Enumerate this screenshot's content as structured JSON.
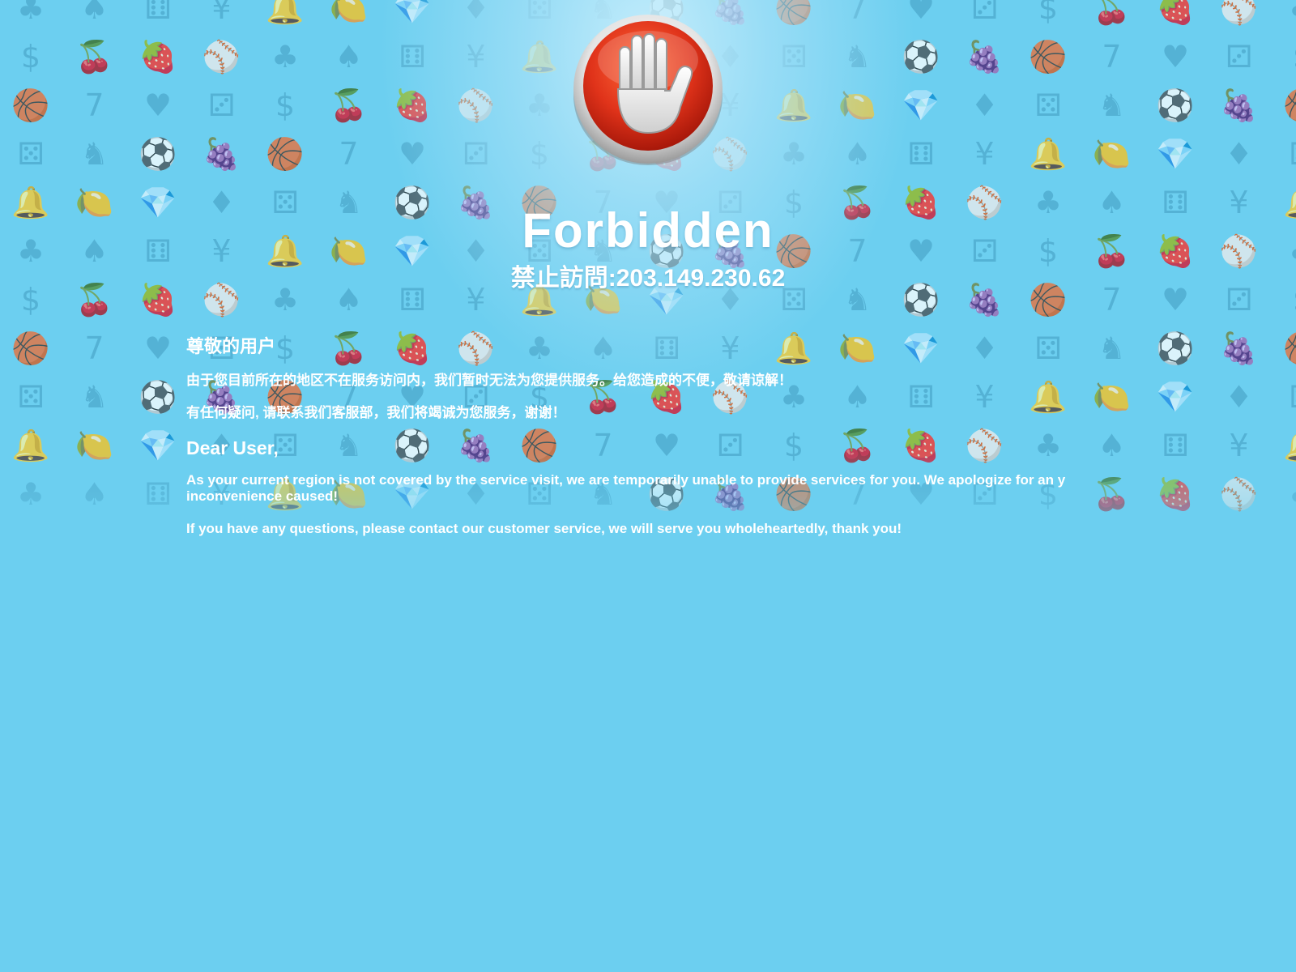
{
  "title": "Forbidden",
  "subtitle": "禁止訪問:203.149.230.62",
  "message": {
    "greeting_cn": "尊敬的用户",
    "para1_cn": "由于您目前所在的地区不在服务访问内，我们暂时无法为您提供服务。给您造成的不便，敬请谅解！",
    "para2_cn": "有任何疑问, 请联系我们客服部，我们将竭诚为您服务，谢谢！",
    "greeting_en": "Dear User,",
    "para1_en": "As your current region is not covered by the service visit, we are temporarily unable to provide services for you. We apologize for an y inconvenience caused!",
    "para2_en": "If you have any questions, please contact our customer service, we will serve you wholeheartedly, thank you!"
  },
  "icons": {
    "stop_sign": "stop-hand-icon",
    "background_glyphs": [
      "♣",
      "♦",
      "♥",
      "♠",
      "⚄",
      "⚂",
      "⚅",
      "♞",
      "$",
      "¥",
      "⚽",
      "🍒",
      "🔔",
      "🍇",
      "🍓",
      "🍋",
      "🏀",
      "⚾",
      "💎",
      "7"
    ]
  },
  "colors": {
    "background": "#6ccff0",
    "pattern": "#4da9cc",
    "text": "#ffffff",
    "stop_red": "#e0331a"
  }
}
